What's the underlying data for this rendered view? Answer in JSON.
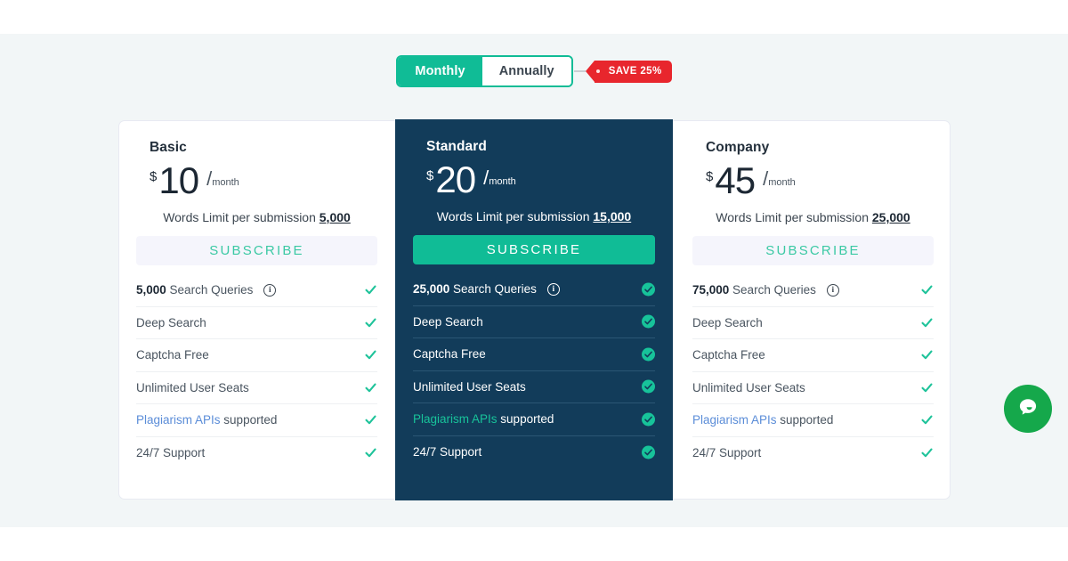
{
  "colors": {
    "band_bg": "#f2f6f7",
    "accent_green": "#10bc96",
    "featured_bg": "#123c5a",
    "badge_red": "#e8262d",
    "link_blue": "#5b8dd8",
    "chat_green": "#15a84b"
  },
  "billing_toggle": {
    "monthly_label": "Monthly",
    "annually_label": "Annually",
    "selected": "Monthly",
    "save_badge": "SAVE 25%"
  },
  "plans": [
    {
      "name": "Basic",
      "currency": "$",
      "amount": "10",
      "slash": "/",
      "period": "month",
      "words_limit_prefix": "Words Limit per submission ",
      "words_limit_value": "5,000",
      "cta": "SUBSCRIBE",
      "featured": false,
      "features": [
        {
          "bold": "5,000",
          "text": " Search Queries",
          "link": "",
          "suffix": "",
          "info": true,
          "checked": true
        },
        {
          "bold": "",
          "text": "Deep Search",
          "link": "",
          "suffix": "",
          "info": false,
          "checked": true
        },
        {
          "bold": "",
          "text": "Captcha Free",
          "link": "",
          "suffix": "",
          "info": false,
          "checked": true
        },
        {
          "bold": "",
          "text": "Unlimited User Seats",
          "link": "",
          "suffix": "",
          "info": false,
          "checked": true
        },
        {
          "bold": "",
          "text": "",
          "link": "Plagiarism APIs",
          "suffix": " supported",
          "info": false,
          "checked": true
        },
        {
          "bold": "",
          "text": "24/7 Support",
          "link": "",
          "suffix": "",
          "info": false,
          "checked": true
        }
      ]
    },
    {
      "name": "Standard",
      "currency": "$",
      "amount": "20",
      "slash": "/",
      "period": "month",
      "words_limit_prefix": "Words Limit per submission ",
      "words_limit_value": "15,000",
      "cta": "SUBSCRIBE",
      "featured": true,
      "features": [
        {
          "bold": "25,000",
          "text": " Search Queries",
          "link": "",
          "suffix": "",
          "info": true,
          "checked": true
        },
        {
          "bold": "",
          "text": "Deep Search",
          "link": "",
          "suffix": "",
          "info": false,
          "checked": true
        },
        {
          "bold": "",
          "text": "Captcha Free",
          "link": "",
          "suffix": "",
          "info": false,
          "checked": true
        },
        {
          "bold": "",
          "text": "Unlimited User Seats",
          "link": "",
          "suffix": "",
          "info": false,
          "checked": true
        },
        {
          "bold": "",
          "text": "",
          "link": "Plagiarism APIs",
          "suffix": " supported",
          "info": false,
          "checked": true
        },
        {
          "bold": "",
          "text": "24/7 Support",
          "link": "",
          "suffix": "",
          "info": false,
          "checked": true
        }
      ]
    },
    {
      "name": "Company",
      "currency": "$",
      "amount": "45",
      "slash": "/",
      "period": "month",
      "words_limit_prefix": "Words Limit per submission ",
      "words_limit_value": "25,000",
      "cta": "SUBSCRIBE",
      "featured": false,
      "features": [
        {
          "bold": "75,000",
          "text": " Search Queries",
          "link": "",
          "suffix": "",
          "info": true,
          "checked": true
        },
        {
          "bold": "",
          "text": "Deep Search",
          "link": "",
          "suffix": "",
          "info": false,
          "checked": true
        },
        {
          "bold": "",
          "text": "Captcha Free",
          "link": "",
          "suffix": "",
          "info": false,
          "checked": true
        },
        {
          "bold": "",
          "text": "Unlimited User Seats",
          "link": "",
          "suffix": "",
          "info": false,
          "checked": true
        },
        {
          "bold": "",
          "text": "",
          "link": "Plagiarism APIs",
          "suffix": " supported",
          "info": false,
          "checked": true
        },
        {
          "bold": "",
          "text": "24/7 Support",
          "link": "",
          "suffix": "",
          "info": false,
          "checked": true
        }
      ]
    }
  ],
  "chat_widget": {
    "icon": "chat-bubble-icon"
  },
  "info_icon_glyph": "i"
}
